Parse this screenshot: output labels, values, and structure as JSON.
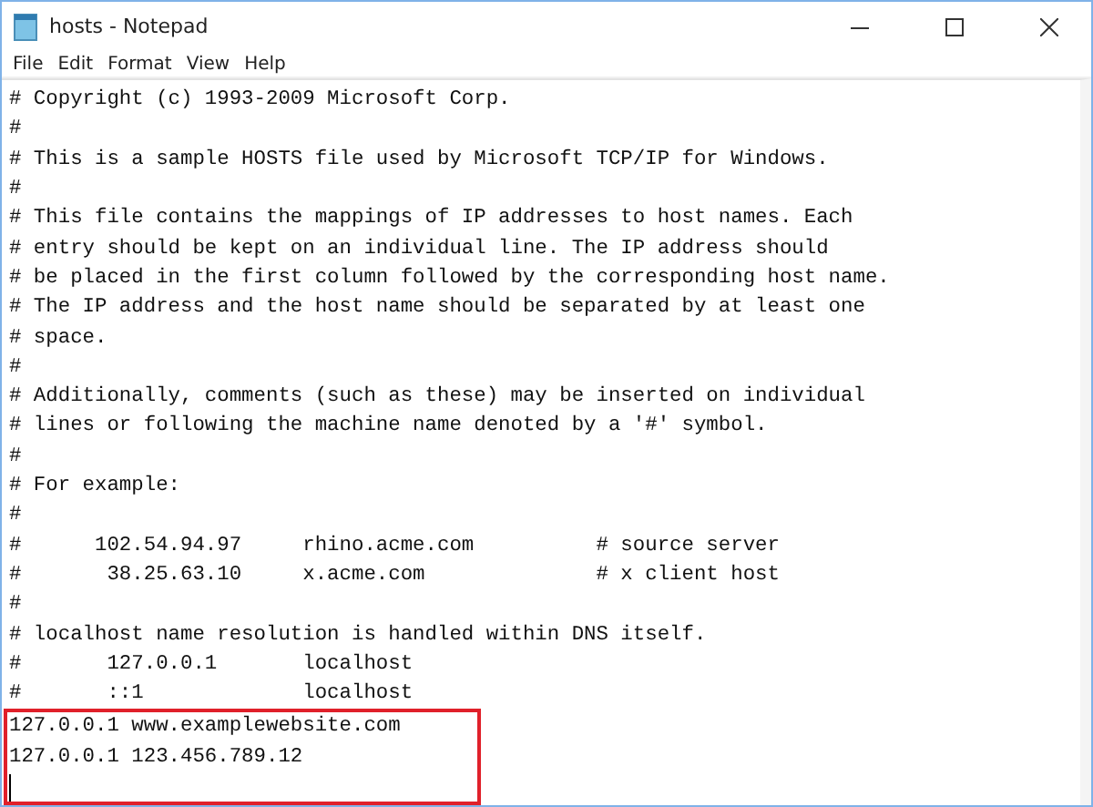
{
  "window": {
    "title": "hosts - Notepad"
  },
  "menu": [
    "File",
    "Edit",
    "Format",
    "View",
    "Help"
  ],
  "lines": [
    "# Copyright (c) 1993-2009 Microsoft Corp.",
    "#",
    "# This is a sample HOSTS file used by Microsoft TCP/IP for Windows.",
    "#",
    "# This file contains the mappings of IP addresses to host names. Each",
    "# entry should be kept on an individual line. The IP address should",
    "# be placed in the first column followed by the corresponding host name.",
    "# The IP address and the host name should be separated by at least one",
    "# space.",
    "#",
    "# Additionally, comments (such as these) may be inserted on individual",
    "# lines or following the machine name denoted by a '#' symbol.",
    "#",
    "# For example:",
    "#",
    "#      102.54.94.97     rhino.acme.com          # source server",
    "#       38.25.63.10     x.acme.com              # x client host",
    "#",
    "# localhost name resolution is handled within DNS itself.",
    "#       127.0.0.1       localhost",
    "#       ::1             localhost"
  ],
  "highlighted_lines": [
    "127.0.0.1 www.examplewebsite.com",
    "127.0.0.1 123.456.789.12"
  ]
}
